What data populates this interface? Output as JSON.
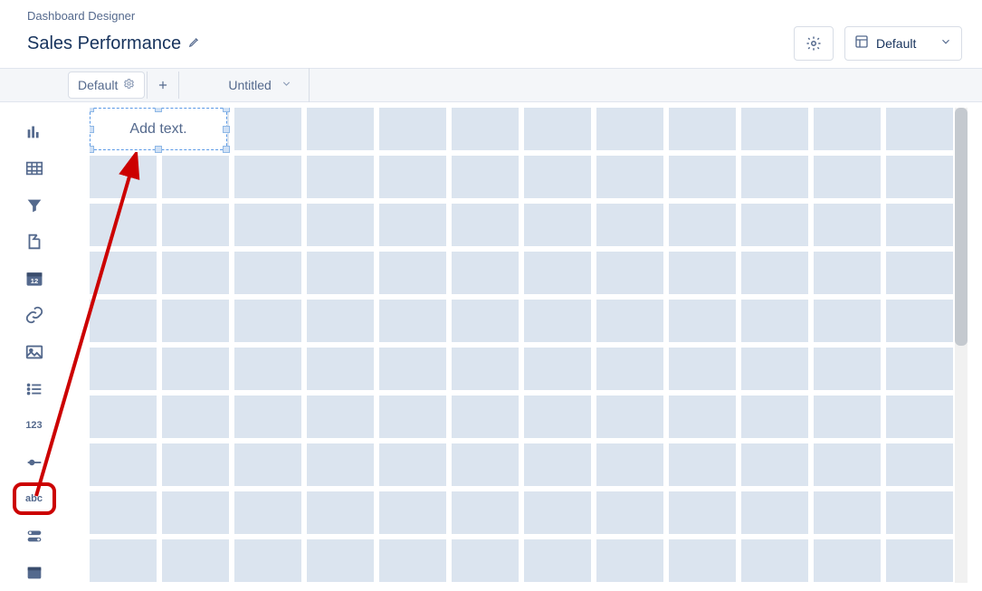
{
  "header": {
    "breadcrumb": "Dashboard Designer",
    "title": "Sales Performance",
    "layout_selector": {
      "label": "Default"
    }
  },
  "tabs": {
    "default_tab": "Default",
    "untitled_tab": "Untitled"
  },
  "sidebar": {
    "items": [
      {
        "name": "chart",
        "iconLabel": ""
      },
      {
        "name": "table",
        "iconLabel": ""
      },
      {
        "name": "filter",
        "iconLabel": ""
      },
      {
        "name": "container",
        "iconLabel": ""
      },
      {
        "name": "date",
        "iconLabel": "12"
      },
      {
        "name": "link",
        "iconLabel": ""
      },
      {
        "name": "image",
        "iconLabel": ""
      },
      {
        "name": "list",
        "iconLabel": ""
      },
      {
        "name": "number",
        "iconLabel": "123"
      },
      {
        "name": "range",
        "iconLabel": ""
      },
      {
        "name": "text",
        "iconLabel": "abc"
      },
      {
        "name": "toggle",
        "iconLabel": ""
      },
      {
        "name": "navigation",
        "iconLabel": ""
      }
    ]
  },
  "canvas": {
    "text_widget_placeholder": "Add text."
  }
}
